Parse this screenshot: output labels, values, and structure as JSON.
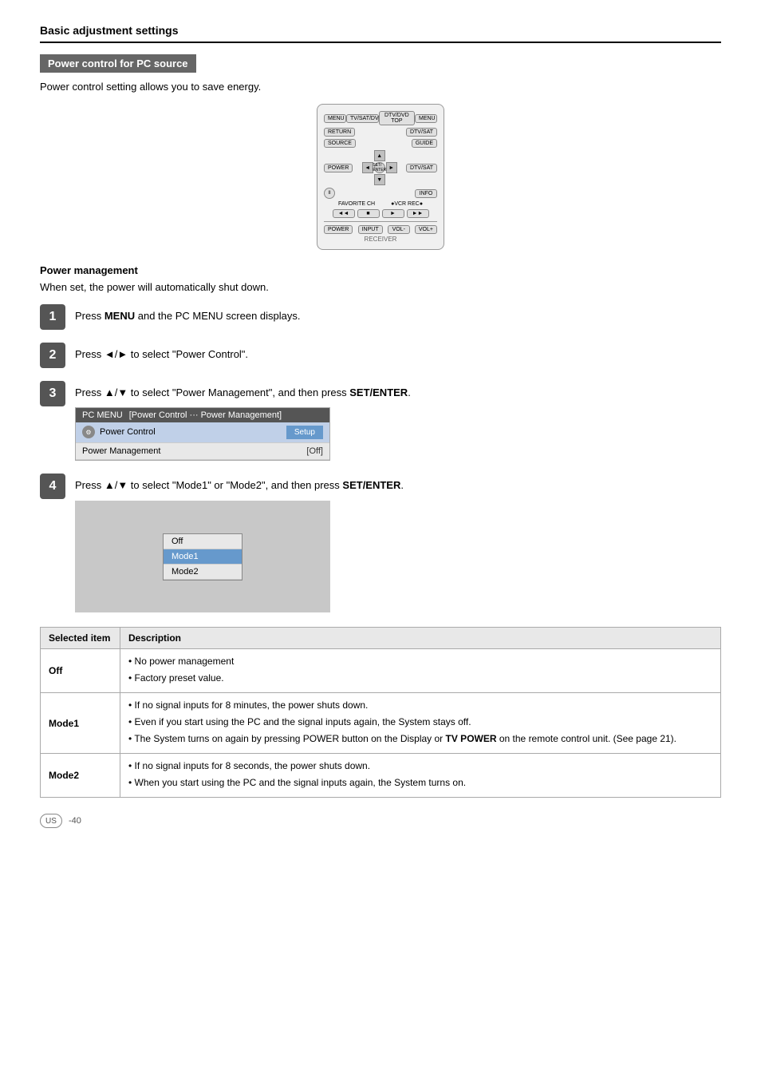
{
  "page": {
    "heading": "Basic adjustment settings",
    "section_title": "Power control for PC source",
    "intro": "Power control setting allows you to save energy.",
    "sub_heading": "Power management",
    "sub_intro": "When set, the power will automatically shut down.",
    "footer_label": "US",
    "footer_page": "-40"
  },
  "steps": [
    {
      "number": "1",
      "text_parts": [
        {
          "text": "Press ",
          "bold": false
        },
        {
          "text": "MENU",
          "bold": true
        },
        {
          "text": " and the PC MENU screen displays.",
          "bold": false
        }
      ]
    },
    {
      "number": "2",
      "text_parts": [
        {
          "text": "Press ◄/► to select \"Power Control\".",
          "bold": false
        }
      ]
    },
    {
      "number": "3",
      "text_parts": [
        {
          "text": "Press ▲/▼ to select \"Power Management\", and then press ",
          "bold": false
        },
        {
          "text": "SET/ENTER",
          "bold": true
        },
        {
          "text": ".",
          "bold": false
        }
      ],
      "has_menu": true
    },
    {
      "number": "4",
      "text_parts": [
        {
          "text": "Press ▲/▼ to select \"Mode1\" or \"Mode2\", and then press ",
          "bold": false
        },
        {
          "text": "SET/ENTER",
          "bold": true
        },
        {
          "text": ".",
          "bold": false
        }
      ],
      "has_modes": true
    }
  ],
  "pc_menu": {
    "header_left": "PC MENU",
    "header_right": "[Power Control ···  Power Management]",
    "row1_label": "Power Control",
    "row1_setup": "Setup",
    "row2_label": "Power Management",
    "row2_value": "[Off]"
  },
  "modes": {
    "options": [
      "Off",
      "Mode1",
      "Mode2"
    ],
    "highlighted": "Mode1"
  },
  "table": {
    "col1": "Selected item",
    "col2": "Description",
    "rows": [
      {
        "item": "Off",
        "bullets": [
          "No power management",
          "Factory preset value."
        ]
      },
      {
        "item": "Mode1",
        "bullets": [
          "If no signal inputs for 8 minutes, the power shuts down.",
          "Even if you start using the PC and the signal inputs again, the System stays off.",
          "The System turns on again by pressing POWER button on the Display or TV POWER on the remote control unit. (See page 21)."
        ],
        "bold_in_bullets": [
          "POWER",
          "TV",
          "POWER"
        ]
      },
      {
        "item": "Mode2",
        "bullets": [
          "If no signal inputs for 8 seconds, the power shuts down.",
          "When you start using the PC and the signal inputs again, the System turns on."
        ]
      }
    ]
  },
  "remote": {
    "label": "RECEIVER"
  }
}
